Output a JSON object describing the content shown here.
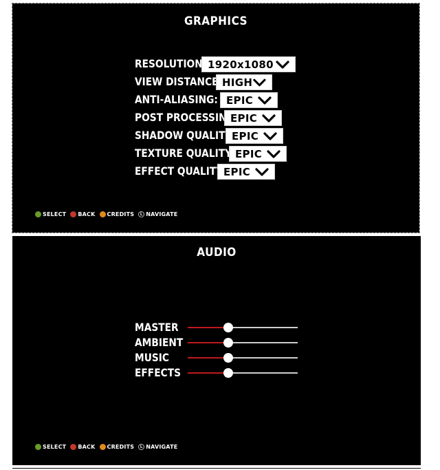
{
  "graphics": {
    "title": "GRAPHICS",
    "settings": [
      {
        "label": "RESOLUTION:",
        "value": "1920x1080"
      },
      {
        "label": "VIEW DISTANCE:",
        "value": "HIGH"
      },
      {
        "label": "ANTI-ALIASING:",
        "value": "EPIC"
      },
      {
        "label": "POST PROCESSING:",
        "value": "EPIC"
      },
      {
        "label": "SHADOW QUALITY:",
        "value": "EPIC"
      },
      {
        "label": "TEXTURE QUALITY:",
        "value": "EPIC"
      },
      {
        "label": "EFFECT QUALITY:",
        "value": "EPIC"
      }
    ],
    "footer": {
      "select": "SELECT",
      "back": "BACK",
      "credits": "CREDITS",
      "navigate": "NAVIGATE",
      "navigate_key": "L"
    }
  },
  "audio": {
    "title": "AUDIO",
    "sliders": [
      {
        "label": "MASTER",
        "level": 0.37
      },
      {
        "label": "AMBIENT",
        "level": 0.37
      },
      {
        "label": "MUSIC",
        "level": 0.37
      },
      {
        "label": "EFFECTS",
        "level": 0.37
      }
    ],
    "footer": {
      "select": "SELECT",
      "back": "BACK",
      "credits": "CREDITS",
      "navigate": "NAVIGATE",
      "navigate_key": "L"
    }
  },
  "colors": {
    "background": "#000000",
    "text": "#ffffff",
    "slider_fill": "#c0191c",
    "slider_track": "#cfcfcf",
    "select_button": "#6a9a2a",
    "back_button": "#c0392b",
    "credits_button": "#e08a1e"
  },
  "icons": {
    "dropdown": "chevron-down-icon",
    "select": "green-button-icon",
    "back": "red-button-icon",
    "credits": "orange-button-icon",
    "navigate": "left-stick-icon"
  }
}
